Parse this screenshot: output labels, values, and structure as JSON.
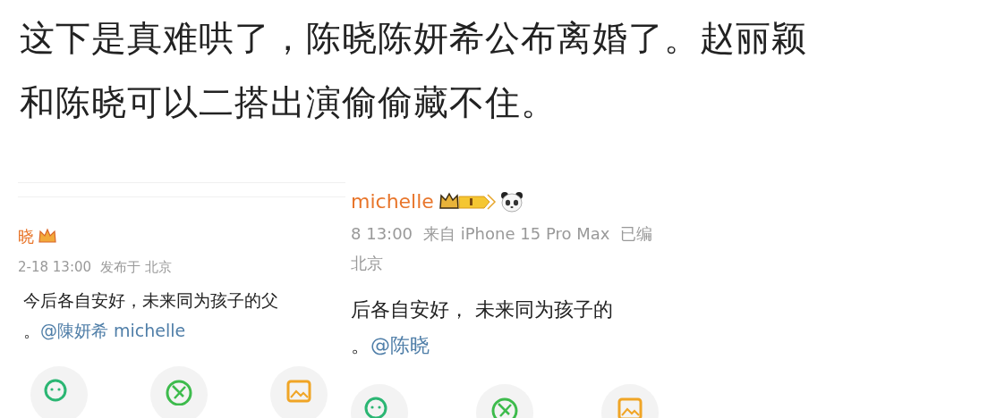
{
  "headline": [
    "这下是真难哄了，陈晓陈妍希公布离婚了。赵丽颖",
    "和陈晓可以二搭出演偷偷藏不住。"
  ],
  "posts": [
    {
      "name": "晓",
      "meta": [
        "2-18 13:00",
        "发布于 北京"
      ],
      "lines": [
        {
          "text": "今后各自安好，未来同为孩子的父"
        },
        {
          "text": "。",
          "mention": "@陳妍希 michelle"
        }
      ]
    },
    {
      "name": "michelle",
      "meta": [
        "8 13:00",
        "来自 iPhone 15 Pro Max",
        "已编"
      ],
      "location": "北京",
      "lines": [
        {
          "text": "后各自安好， 未来同为孩子的"
        },
        {
          "text": "。",
          "mention": "@陈晓"
        }
      ]
    }
  ]
}
